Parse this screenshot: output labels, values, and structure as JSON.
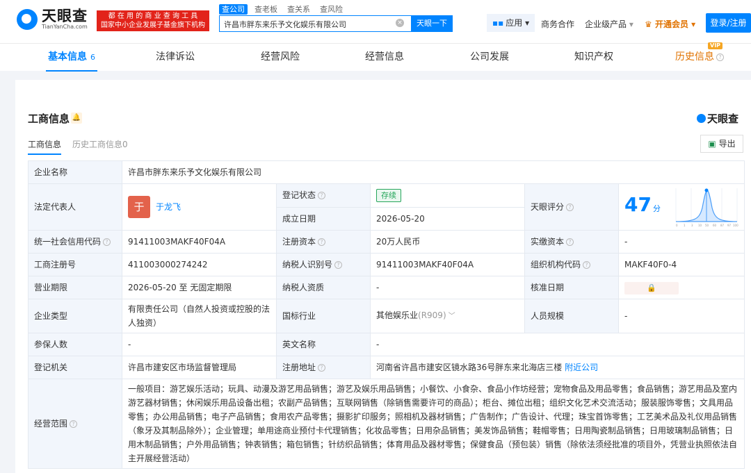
{
  "header": {
    "logo_cn": "天眼查",
    "logo_en": "TianYanCha.com",
    "slogan_line1": "都 在 用 的 商 业 查 询 工 具",
    "slogan_line2": "国家中小企业发展子基金旗下机构",
    "search_tabs": [
      "查公司",
      "查老板",
      "查关系",
      "查风险"
    ],
    "search_value": "许昌市胖东来乐予文化娱乐有限公司",
    "search_button": "天眼一下",
    "apps_label": "应用",
    "nav_links": [
      "商务合作",
      "企业级产品",
      "开通会员"
    ],
    "login_label": "登录/注册"
  },
  "tabs": {
    "items": [
      "基本信息",
      "法律诉讼",
      "经营风险",
      "经营信息",
      "公司发展",
      "知识产权",
      "历史信息"
    ],
    "basic_count": "6",
    "vip_badge": "VIP"
  },
  "section": {
    "title": "工商信息",
    "brand": "天眼查",
    "subtab_current": "工商信息",
    "subtab_history": "历史工商信息0",
    "export_label": "导出"
  },
  "info": {
    "company_name_label": "企业名称",
    "company_name": "许昌市胖东来乐予文化娱乐有限公司",
    "legal_rep_label": "法定代表人",
    "legal_rep_avatar": "于",
    "legal_rep_name": "于龙飞",
    "status_label": "登记状态",
    "status_value": "存续",
    "founded_label": "成立日期",
    "founded_value": "2026-05-20",
    "score_label": "天眼评分",
    "score_value": "47",
    "score_unit": "分",
    "score_axis": [
      "0",
      "1",
      "3",
      "10",
      "50",
      "60",
      "87",
      "97",
      "100"
    ],
    "credit_code_label": "统一社会信用代码",
    "credit_code": "91411003MAKF40F04A",
    "reg_capital_label": "注册资本",
    "reg_capital": "20万人民币",
    "paid_capital_label": "实缴资本",
    "paid_capital": "-",
    "reg_no_label": "工商注册号",
    "reg_no": "411003000274242",
    "taxpayer_id_label": "纳税人识别号",
    "taxpayer_id": "91411003MAKF40F04A",
    "org_code_label": "组织机构代码",
    "org_code": "MAKF40F0-4",
    "term_label": "营业期限",
    "term_value": "2026-05-20 至 无固定期限",
    "taxpayer_qual_label": "纳税人资质",
    "taxpayer_qual": "-",
    "approve_date_label": "核准日期",
    "company_type_label": "企业类型",
    "company_type": "有限责任公司（自然人投资或控股的法人独资）",
    "industry_label": "国标行业",
    "industry_value": "其他娱乐业",
    "industry_code": "(R909)",
    "staff_label": "人员规模",
    "staff_value": "-",
    "insured_label": "参保人数",
    "insured_value": "-",
    "en_name_label": "英文名称",
    "en_name": "-",
    "authority_label": "登记机关",
    "authority": "许昌市建安区市场监督管理局",
    "address_label": "注册地址",
    "address": "河南省许昌市建安区镜水路36号胖东来北海店三楼",
    "nearby_link": "附近公司",
    "scope_label": "经营范围",
    "scope": "一般项目：游艺娱乐活动；玩具、动漫及游艺用品销售；游艺及娱乐用品销售；小餐饮、小食杂、食品小作坊经营；宠物食品及用品零售；食品销售；游艺用品及室内游艺器材销售；休闲娱乐用品设备出租；农副产品销售；互联网销售（除销售需要许可的商品）；柜台、摊位出租；组织文化艺术交流活动；服装服饰零售；文具用品零售；办公用品销售；电子产品销售；食用农产品零售；摄影扩印服务；照相机及器材销售；广告制作；广告设计、代理；珠宝首饰零售；工艺美术品及礼仪用品销售（象牙及其制品除外）；企业管理；单用途商业预付卡代理销售；化妆品零售；日用杂品销售；美发饰品销售；鞋帽零售；日用陶瓷制品销售；日用玻璃制品销售；日用木制品销售；户外用品销售；钟表销售；箱包销售；针纺织品销售；体育用品及器材零售；保健食品（预包装）销售（除依法须经批准的项目外，凭营业执照依法自主开展经营活动）"
  },
  "colors": {
    "brand_blue": "#0084ff",
    "slogan_red": "#e2231a",
    "vip_orange": "#e07200",
    "active_green": "#26a65b"
  }
}
